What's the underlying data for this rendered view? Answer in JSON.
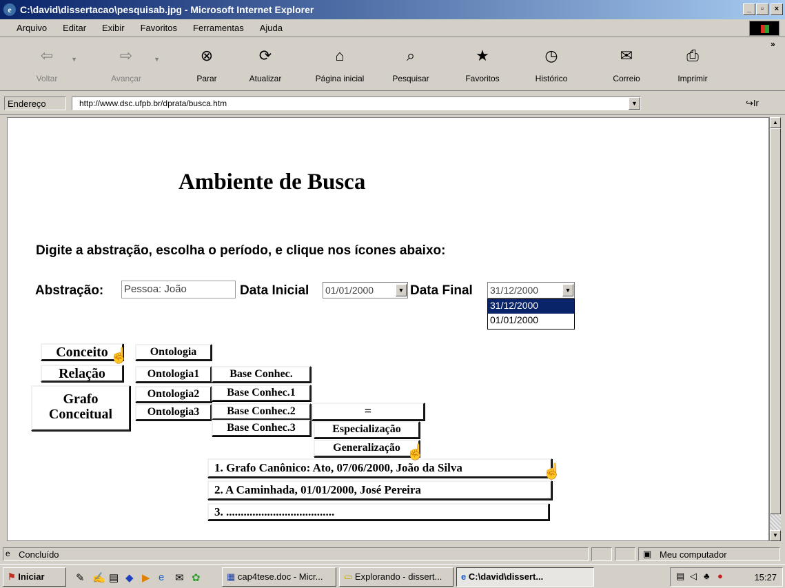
{
  "window": {
    "title": "C:\\david\\dissertacao\\pesquisab.jpg - Microsoft Internet Explorer"
  },
  "menu": [
    "Arquivo",
    "Editar",
    "Exibir",
    "Favoritos",
    "Ferramentas",
    "Ajuda"
  ],
  "toolbar": {
    "back": "Voltar",
    "forward": "Avançar",
    "stop": "Parar",
    "refresh": "Atualizar",
    "home": "Página inicial",
    "search": "Pesquisar",
    "favorites": "Favoritos",
    "history": "Histórico",
    "mail": "Correio",
    "print": "Imprimir"
  },
  "address": {
    "label": "Endereço",
    "url": "http://www.dsc.ufpb.br/dprata/busca.htm",
    "go": "Ir"
  },
  "page": {
    "title": "Ambiente de Busca",
    "instructions": "Digite a abstração, escolha o período, e clique nos ícones abaixo:",
    "abstraction_label": "Abstração:",
    "abstraction_value": "Pessoa: João",
    "start_label": "Data Inicial",
    "start_value": "01/01/2000",
    "end_label": "Data Final",
    "end_value": "31/12/2000",
    "end_options": [
      "31/12/2000",
      "01/01/2000"
    ]
  },
  "buttons": {
    "conceito": "Conceito",
    "relacao": "Relação",
    "grafo_1": "Grafo",
    "grafo_2": "Conceitual",
    "ontologia": "Ontologia",
    "ontologia1": "Ontologia1",
    "ontologia2": "Ontologia2",
    "ontologia3": "Ontologia3",
    "base": "Base Conhec.",
    "base1": "Base Conhec.1",
    "base2": "Base Conhec.2",
    "base3": "Base Conhec.3",
    "equals": "=",
    "especializacao": "Especialização",
    "generalizacao": "Generalização",
    "result1": "1. Grafo Canônico: Ato, 07/06/2000, João da Silva",
    "result2": "2. A Caminhada, 01/01/2000, José Pereira",
    "result3": "3. ....................................."
  },
  "status": {
    "text": "Concluído",
    "zone": "Meu computador"
  },
  "taskbar": {
    "start": "Iniciar",
    "task1": "cap4tese.doc - Micr...",
    "task2": "Explorando - dissert...",
    "task3": "C:\\david\\dissert...",
    "clock": "15:27"
  }
}
